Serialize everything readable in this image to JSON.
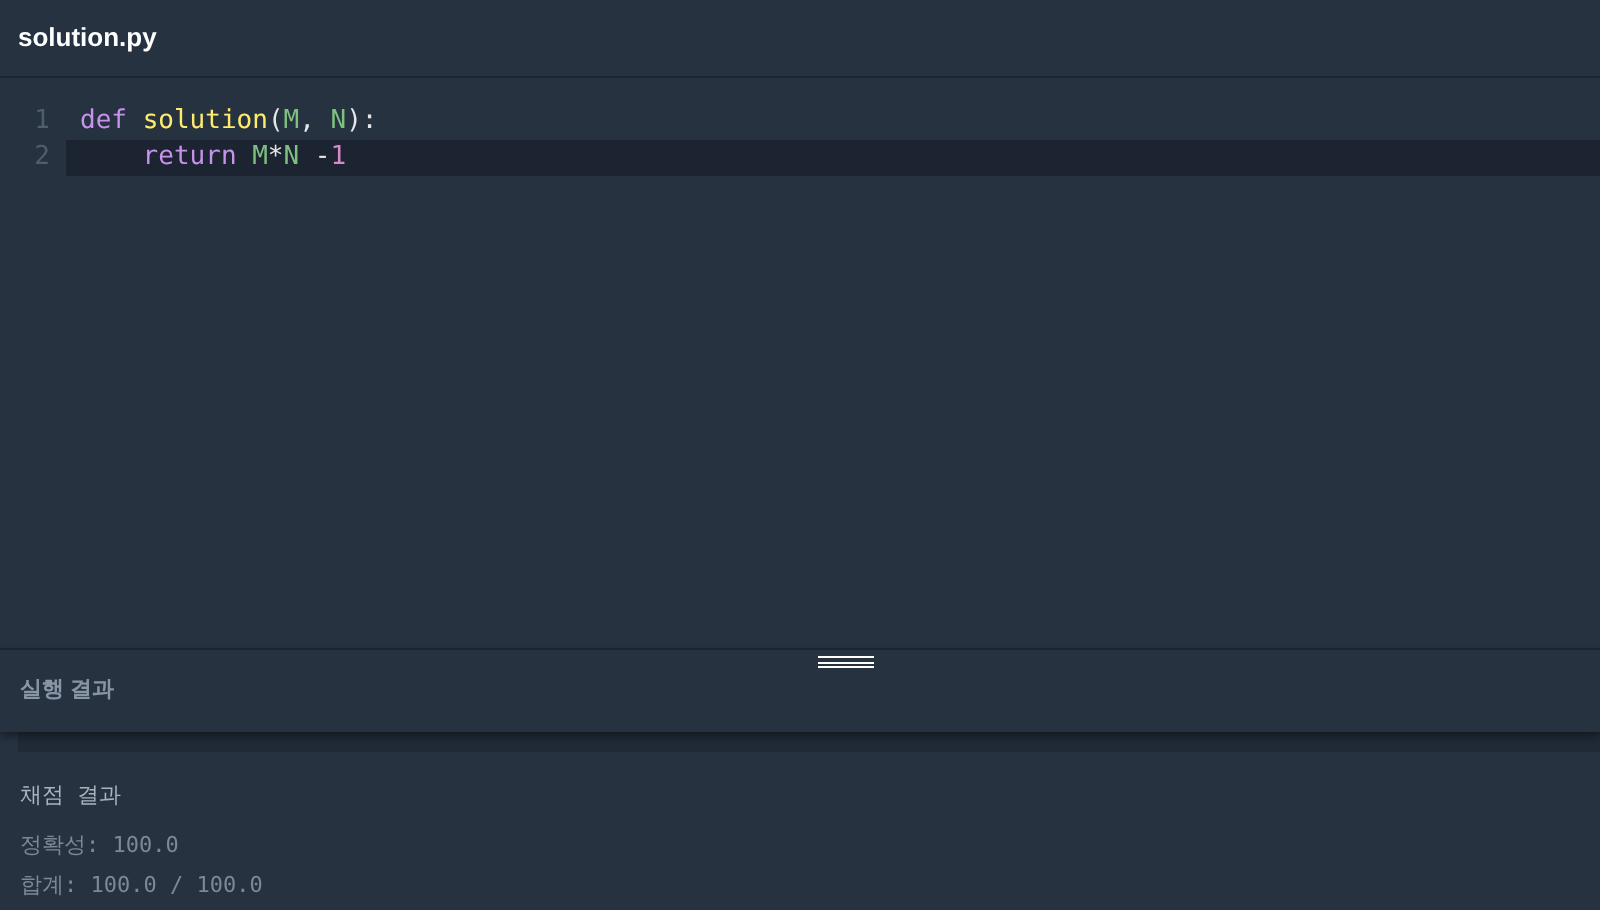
{
  "file_tab": {
    "title": "solution.py"
  },
  "editor": {
    "lines": [
      {
        "number": "1",
        "current": false,
        "tokens": [
          {
            "kind": "keyword",
            "text": "def "
          },
          {
            "kind": "function",
            "text": "solution"
          },
          {
            "kind": "plain",
            "text": "("
          },
          {
            "kind": "param",
            "text": "M"
          },
          {
            "kind": "plain",
            "text": ", "
          },
          {
            "kind": "param",
            "text": "N"
          },
          {
            "kind": "plain",
            "text": "):"
          }
        ]
      },
      {
        "number": "2",
        "current": true,
        "tokens": [
          {
            "kind": "keyword",
            "text": "    return "
          },
          {
            "kind": "param",
            "text": "M"
          },
          {
            "kind": "plain",
            "text": "*"
          },
          {
            "kind": "param",
            "text": "N"
          },
          {
            "kind": "plain",
            "text": " -"
          },
          {
            "kind": "number",
            "text": "1"
          }
        ]
      }
    ]
  },
  "results_panel": {
    "title": "실행 결과"
  },
  "grading": {
    "title": "채점 결과",
    "lines": [
      "정확성: 100.0",
      "합계: 100.0 / 100.0"
    ]
  }
}
